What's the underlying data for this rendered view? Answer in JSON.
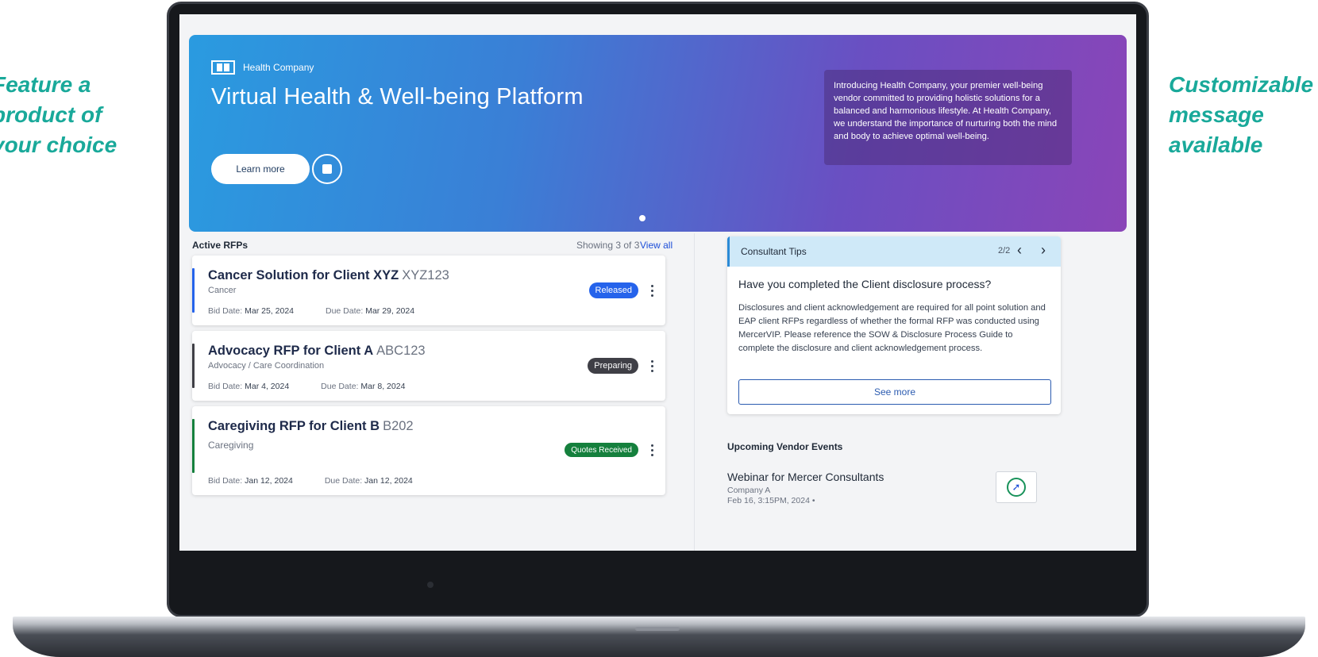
{
  "callouts": {
    "left": [
      "Feature a",
      "product of",
      "your choice"
    ],
    "right": [
      "Customizable",
      "message",
      "available"
    ]
  },
  "hero": {
    "brand_name": "Health Company",
    "title": "Virtual Health & Well-being Platform",
    "learn_more": "Learn more",
    "message": "Introducing Health Company, your premier well-being vendor committed to providing holistic solutions for a balanced and harmonious lifestyle. At Health Company, we understand the importance of nurturing both the mind and body to achieve optimal well-being."
  },
  "rfps": {
    "heading": "Active RFPs",
    "showing": "Showing 3 of 3",
    "view_all": "View all",
    "items": [
      {
        "title": "Cancer Solution for Client XYZ",
        "code": "XYZ123",
        "category": "Cancer",
        "bid_label": "Bid Date:",
        "bid_date": "Mar 25, 2024",
        "due_label": "Due Date:",
        "due_date": "Mar 29, 2024",
        "status": "Released",
        "status_color": "#2563eb",
        "bar_color": "#2563eb"
      },
      {
        "title": "Advocacy RFP for Client A",
        "code": "ABC123",
        "category": "Advocacy / Care Coordination",
        "bid_label": "Bid Date:",
        "bid_date": "Mar 4, 2024",
        "due_label": "Due Date:",
        "due_date": "Mar 8, 2024",
        "status": "Preparing",
        "status_color": "#3f3f46",
        "bar_color": "#3f3f46"
      },
      {
        "title": "Caregiving RFP for Client B",
        "code": "B202",
        "category": "Caregiving",
        "bid_label": "Bid Date:",
        "bid_date": "Jan 12, 2024",
        "due_label": "Due Date:",
        "due_date": "Jan 12, 2024",
        "status": "Quotes Received",
        "status_color": "#15803d",
        "bar_color": "#15803d"
      }
    ]
  },
  "tips": {
    "title": "Consultant Tips",
    "page": "2/2",
    "question": "Have you completed the Client disclosure process?",
    "body": "Disclosures and client acknowledgement are required for all point solution and EAP client RFPs regardless of whether the formal RFP was conducted using MercerVIP. Please reference the SOW & Disclosure Process Guide to complete the disclosure and client acknowledgement process.",
    "see_more": "See more"
  },
  "events": {
    "heading": "Upcoming Vendor Events",
    "items": [
      {
        "title": "Webinar for Mercer Consultants",
        "company": "Company A",
        "date": "Feb 16, 3:15PM, 2024 •"
      }
    ]
  }
}
